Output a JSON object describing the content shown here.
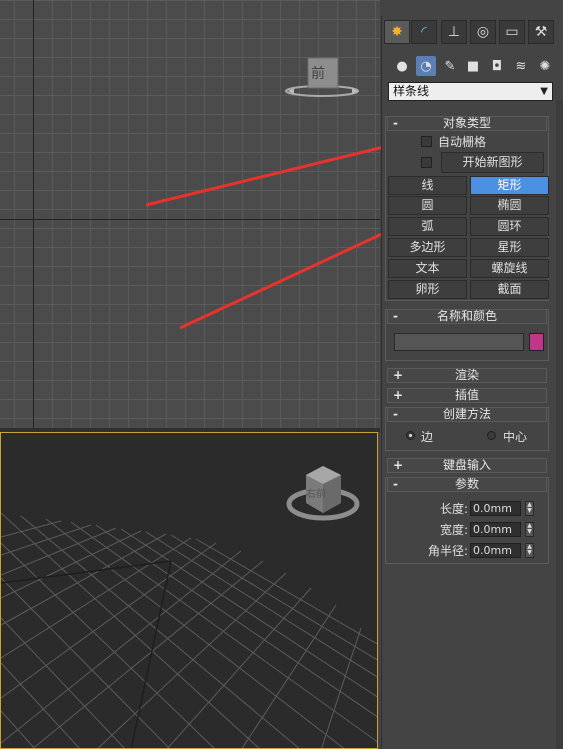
{
  "viewport_front": {
    "label": "前"
  },
  "viewport_persp": {
    "cube_label": "右前"
  },
  "command_panel": {
    "tabs": [
      "create-tab",
      "modify-tab",
      "hierarchy-tab",
      "motion-tab",
      "display-tab",
      "utilities-tab"
    ],
    "subcategories": [
      "geometry",
      "shapes",
      "lights",
      "cameras",
      "helpers",
      "spacewarps",
      "systems"
    ],
    "category": "样条线",
    "object_type": {
      "title": "对象类型",
      "autogrid": "自动栅格",
      "start_new_shape": "开始新图形",
      "buttons": [
        "线",
        "矩形",
        "圆",
        "椭圆",
        "弧",
        "圆环",
        "多边形",
        "星形",
        "文本",
        "螺旋线",
        "卵形",
        "截面"
      ],
      "active": "矩形"
    },
    "name_color": {
      "title": "名称和颜色",
      "name_value": "",
      "color": "#c2358a"
    },
    "rendering": "渲染",
    "interpolation": "插值",
    "creation_method": {
      "title": "创建方法",
      "opt_edge": "边",
      "opt_center": "中心",
      "selected": "边"
    },
    "keyboard_entry": "键盘输入",
    "parameters": {
      "title": "参数",
      "length_label": "长度:",
      "length_value": "0.0mm",
      "width_label": "宽度:",
      "width_value": "0.0mm",
      "corner_label": "角半径:",
      "corner_value": "0.0mm"
    }
  },
  "colors": {
    "arrow": "#e8322c",
    "active_button": "#4d8fe0",
    "viewport_border": "#c9a33a"
  }
}
